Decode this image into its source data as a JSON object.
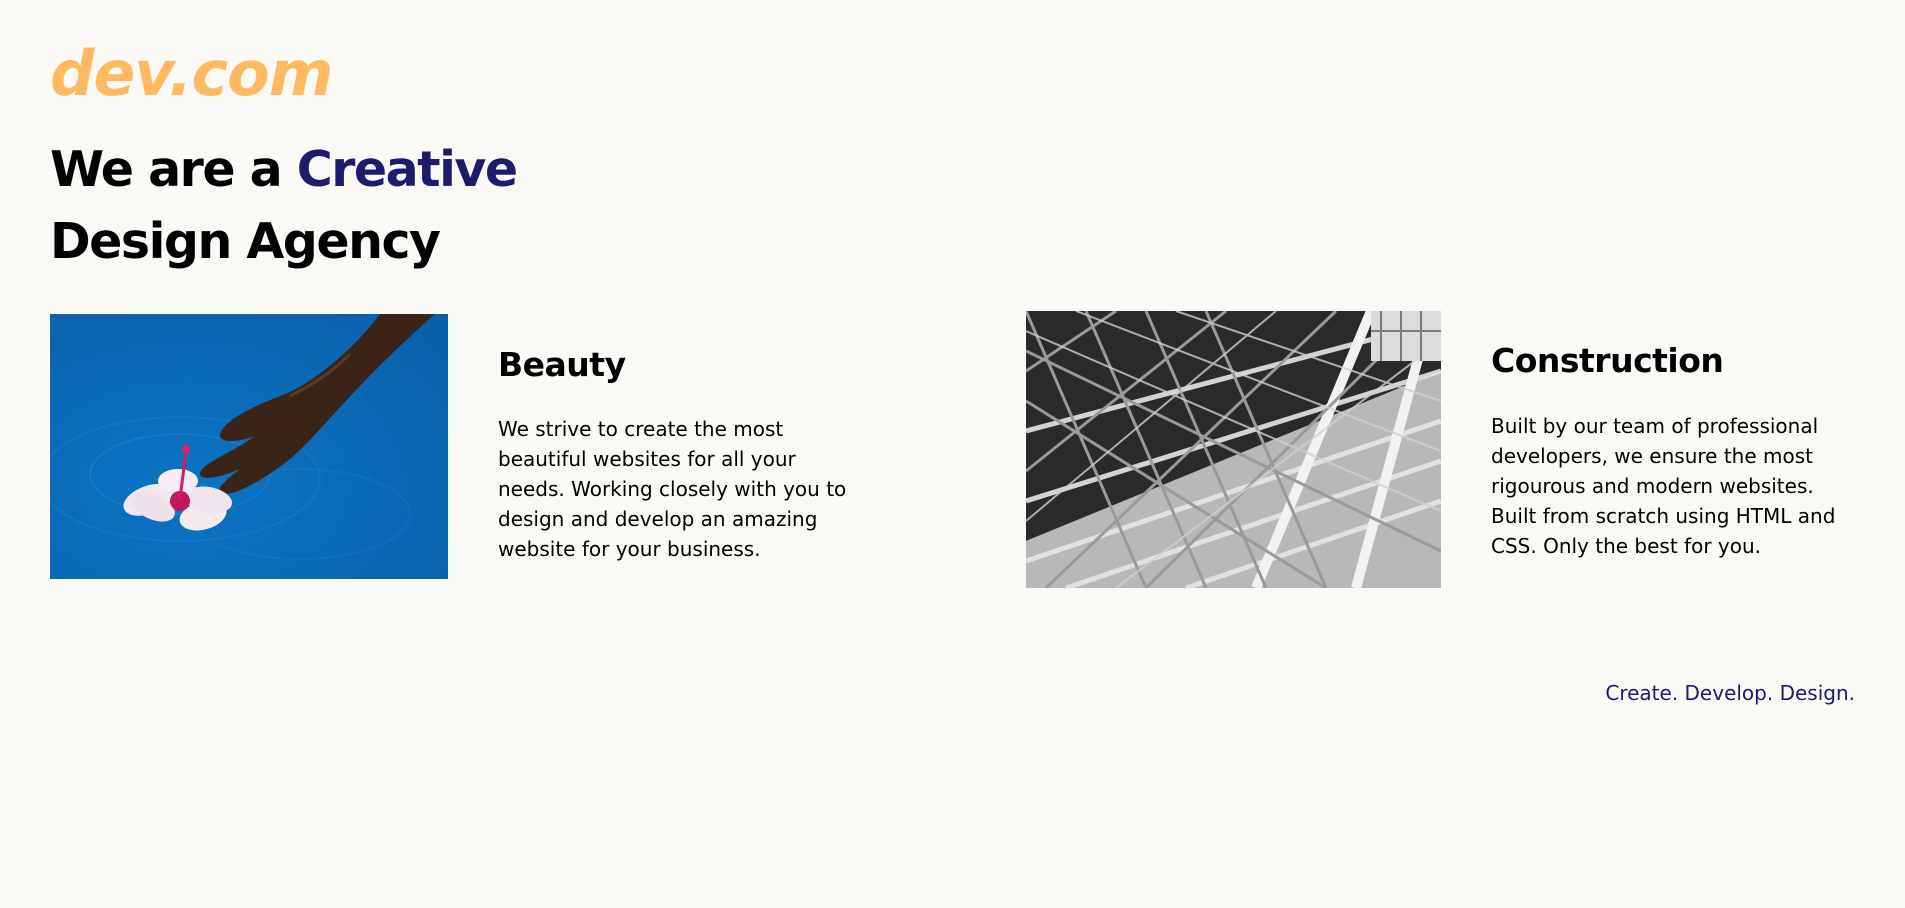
{
  "header": {
    "logo": "dev.com",
    "headline_prefix": "We are a ",
    "headline_accent": "Creative",
    "headline_line2": "Design Agency"
  },
  "cards": [
    {
      "title": "Beauty",
      "text": "We strive to create the most beautiful websites for all your needs. Working closely with you to design and develop an amazing website for your business.",
      "image": "hand-touching-flower-in-pool-photo"
    },
    {
      "title": "Construction",
      "text": "Built by our team of professional developers, we ensure the most rigourous and modern websites. Built from scratch using HTML and CSS. Only the best for you.",
      "image": "steel-structure-black-and-white-photo"
    }
  ],
  "footer": {
    "tagline": "Create. Develop. Design."
  },
  "colors": {
    "background": "#faf9f6",
    "logo": "#ffba61",
    "accent": "#1d1b6b",
    "text": "#000000"
  }
}
